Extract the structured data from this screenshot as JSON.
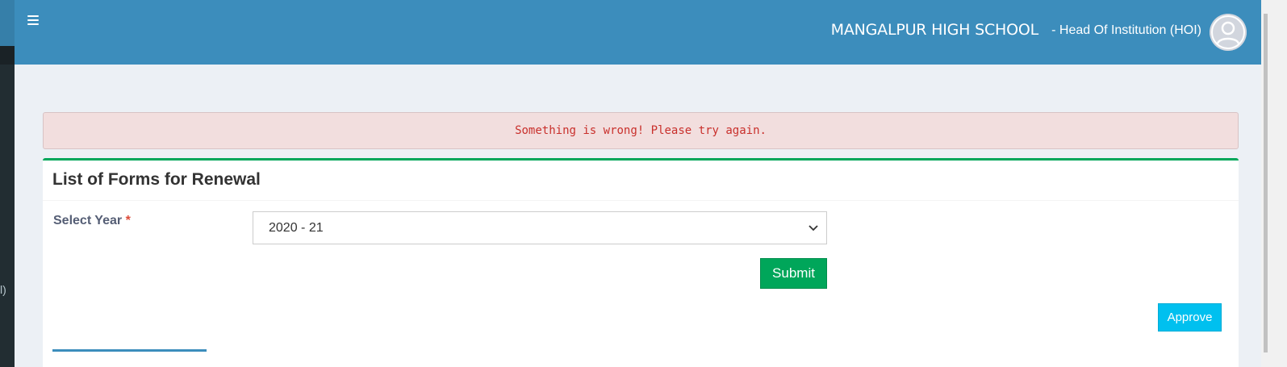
{
  "header": {
    "school_name": "MANGALPUR HIGH SCHOOL",
    "role": "- Head Of Institution (HOI)",
    "menu_icon": "hamburger-menu-icon",
    "avatar_icon": "user-avatar-icon"
  },
  "sidebar": {
    "fragment_text": "l)"
  },
  "alert": {
    "message": "Something is wrong! Please try again."
  },
  "panel": {
    "title": "List of Forms for Renewal",
    "year_label": "Select Year",
    "required_mark": "*",
    "year_selected": "2020 - 21",
    "submit_label": "Submit",
    "approve_label": "Approve"
  },
  "colors": {
    "header_bg": "#3c8dbc",
    "alert_bg": "#f2dede",
    "alert_text": "#c9302c",
    "submit_bg": "#00a65a",
    "approve_bg": "#00c0ef",
    "box_top_border": "#00a65a"
  }
}
